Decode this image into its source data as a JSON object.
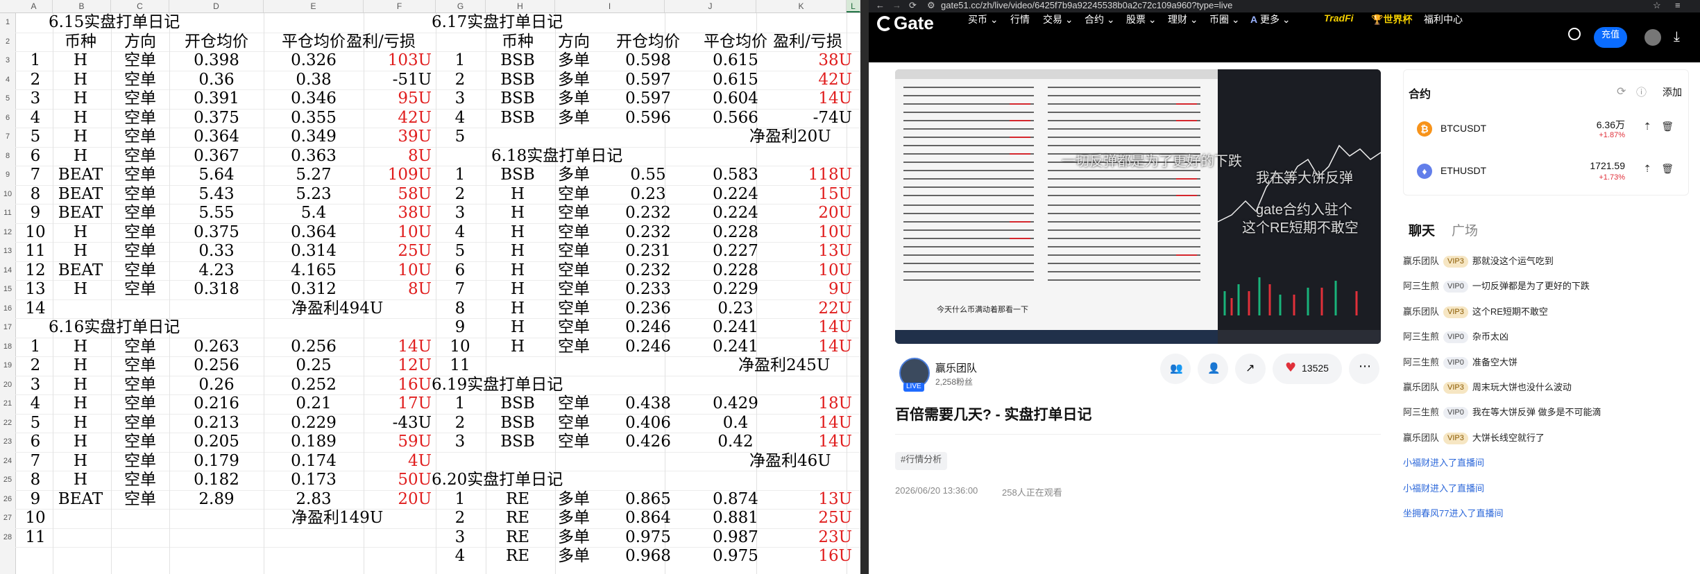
{
  "spreadsheet": {
    "columns": [
      "A",
      "B",
      "C",
      "D",
      "E",
      "F",
      "G",
      "H",
      "I",
      "J",
      "K",
      "L"
    ],
    "rows": [
      "1",
      "2",
      "3",
      "4",
      "5",
      "6",
      "7",
      "8",
      "9",
      "10",
      "11",
      "12",
      "13",
      "14",
      "15",
      "16",
      "17",
      "18",
      "19",
      "20",
      "21",
      "22",
      "23",
      "24",
      "25",
      "26",
      "27",
      "28"
    ],
    "left_block": {
      "d615": {
        "title": "6.15实盘打单日记",
        "headers": [
          "币种",
          "方向",
          "开仓均价",
          "平仓均价",
          "盈利/亏损"
        ],
        "rows": [
          [
            "1",
            "H",
            "空单",
            "0.398",
            "0.326",
            "103U"
          ],
          [
            "2",
            "H",
            "空单",
            "0.36",
            "0.38",
            "-51U"
          ],
          [
            "3",
            "H",
            "空单",
            "0.391",
            "0.346",
            "95U"
          ],
          [
            "4",
            "H",
            "空单",
            "0.375",
            "0.355",
            "42U"
          ],
          [
            "5",
            "H",
            "空单",
            "0.364",
            "0.349",
            "39U"
          ],
          [
            "6",
            "H",
            "空单",
            "0.367",
            "0.363",
            "8U"
          ],
          [
            "7",
            "BEAT",
            "空单",
            "5.64",
            "5.27",
            "109U"
          ],
          [
            "8",
            "BEAT",
            "空单",
            "5.43",
            "5.23",
            "58U"
          ],
          [
            "9",
            "BEAT",
            "空单",
            "5.55",
            "5.4",
            "38U"
          ],
          [
            "10",
            "H",
            "空单",
            "0.375",
            "0.364",
            "10U"
          ],
          [
            "11",
            "H",
            "空单",
            "0.33",
            "0.314",
            "25U"
          ],
          [
            "12",
            "BEAT",
            "空单",
            "4.23",
            "4.165",
            "10U"
          ],
          [
            "13",
            "H",
            "空单",
            "0.318",
            "0.312",
            "8U"
          ]
        ],
        "tail_num": "14",
        "total": "净盈利494U"
      },
      "d616": {
        "title": "6.16实盘打单日记",
        "rows": [
          [
            "1",
            "H",
            "空单",
            "0.263",
            "0.256",
            "14U"
          ],
          [
            "2",
            "H",
            "空单",
            "0.256",
            "0.25",
            "12U"
          ],
          [
            "3",
            "H",
            "空单",
            "0.26",
            "0.252",
            "16U"
          ],
          [
            "4",
            "H",
            "空单",
            "0.216",
            "0.21",
            "17U"
          ],
          [
            "5",
            "H",
            "空单",
            "0.213",
            "0.229",
            "-43U"
          ],
          [
            "6",
            "H",
            "空单",
            "0.205",
            "0.189",
            "59U"
          ],
          [
            "7",
            "H",
            "空单",
            "0.179",
            "0.174",
            "4U"
          ],
          [
            "8",
            "H",
            "空单",
            "0.182",
            "0.173",
            "50U"
          ],
          [
            "9",
            "BEAT",
            "空单",
            "2.89",
            "2.83",
            "20U"
          ]
        ],
        "n10": "10",
        "n11": "11",
        "total": "净盈利149U"
      }
    },
    "right_block": {
      "d617": {
        "title": "6.17实盘打单日记",
        "headers": [
          "币种",
          "方向",
          "开仓均价",
          "平仓均价",
          "盈利/亏损"
        ],
        "rows": [
          [
            "1",
            "BSB",
            "多单",
            "0.598",
            "0.615",
            "38U"
          ],
          [
            "2",
            "BSB",
            "多单",
            "0.597",
            "0.615",
            "42U"
          ],
          [
            "3",
            "BSB",
            "多单",
            "0.597",
            "0.604",
            "14U"
          ],
          [
            "4",
            "BSB",
            "多单",
            "0.596",
            "0.566",
            "-74U"
          ]
        ],
        "n5": "5",
        "total": "净盈利20U"
      },
      "d618": {
        "title": "6.18实盘打单日记",
        "rows": [
          [
            "1",
            "BSB",
            "多单",
            "0.55",
            "0.583",
            "118U"
          ],
          [
            "2",
            "H",
            "空单",
            "0.23",
            "0.224",
            "15U"
          ],
          [
            "3",
            "H",
            "空单",
            "0.232",
            "0.224",
            "20U"
          ],
          [
            "4",
            "H",
            "空单",
            "0.232",
            "0.228",
            "10U"
          ],
          [
            "5",
            "H",
            "空单",
            "0.231",
            "0.227",
            "13U"
          ],
          [
            "6",
            "H",
            "空单",
            "0.232",
            "0.228",
            "10U"
          ],
          [
            "7",
            "H",
            "空单",
            "0.233",
            "0.229",
            "9U"
          ],
          [
            "8",
            "H",
            "空单",
            "0.236",
            "0.23",
            "22U"
          ],
          [
            "9",
            "H",
            "空单",
            "0.246",
            "0.241",
            "14U"
          ],
          [
            "10",
            "H",
            "空单",
            "0.246",
            "0.241",
            "14U"
          ]
        ],
        "n11": "11",
        "total": "净盈利245U"
      },
      "d619": {
        "title": "6.19实盘打单日记",
        "rows": [
          [
            "1",
            "BSB",
            "空单",
            "0.438",
            "0.429",
            "18U"
          ],
          [
            "2",
            "BSB",
            "空单",
            "0.406",
            "0.4",
            "14U"
          ],
          [
            "3",
            "BSB",
            "空单",
            "0.426",
            "0.42",
            "14U"
          ]
        ],
        "total": "净盈利46U"
      },
      "d620": {
        "title": "6.20实盘打单日记",
        "rows": [
          [
            "1",
            "RE",
            "多单",
            "0.865",
            "0.874",
            "13U"
          ],
          [
            "2",
            "RE",
            "多单",
            "0.864",
            "0.881",
            "25U"
          ],
          [
            "3",
            "RE",
            "多单",
            "0.975",
            "0.987",
            "23U"
          ],
          [
            "4",
            "RE",
            "多单",
            "0.968",
            "0.975",
            "16U"
          ]
        ]
      }
    }
  },
  "browser": {
    "url": "gate51.cc/zh/live/video/6425f7b9a92245538b0a2c72c109a960?type=live",
    "nav": {
      "logo": "Gate",
      "items": [
        "买币",
        "行情",
        "交易",
        "合约",
        "股票",
        "理财",
        "币圈",
        "更多"
      ],
      "tradfi": "TradFi",
      "worldcup": "世界杯",
      "welfare": "福利中心",
      "deposit": "充值"
    },
    "video": {
      "overlay_line1": "一切反弹都是为了更好的下跌",
      "overlay_line2": "我在等大饼反弹",
      "overlay_line3": "gate合约入驻个",
      "overlay_line4": "这个RE短期不敢空",
      "caption": "今天什么币满动着那看一下"
    },
    "streamer": {
      "name": "赢乐团队",
      "fans": "2,258粉丝",
      "live": "LIVE",
      "likes": "13525"
    },
    "title": "百倍需要几天? - 实盘打单日记",
    "tag": "#行情分析",
    "time": "2026/06/20 13:36:00",
    "viewers": "258人正在观看",
    "side": {
      "contracts_title": "合约",
      "add_label": "添加",
      "coins": [
        {
          "name": "BTCUSDT",
          "price": "6.36万",
          "change": "+1.87%",
          "icon": "bitcoin-icon",
          "color": "#f7931a"
        },
        {
          "name": "ETHUSDT",
          "price": "1721.59",
          "change": "+1.73%",
          "icon": "ethereum-icon",
          "color": "#627eea"
        }
      ],
      "tabs": [
        "聊天",
        "广场"
      ],
      "chat": [
        {
          "user": "赢乐团队",
          "vip": "VIP3",
          "msg": "那就没这个运气吃到"
        },
        {
          "user": "阿三生煎",
          "vip": "VIP0",
          "msg": "一切反弹都是为了更好的下跌"
        },
        {
          "user": "赢乐团队",
          "vip": "VIP3",
          "msg": "这个RE短期不敢空"
        },
        {
          "user": "阿三生煎",
          "vip": "VIP0",
          "msg": "杂币太凶"
        },
        {
          "user": "阿三生煎",
          "vip": "VIP0",
          "msg": "准备空大饼"
        },
        {
          "user": "赢乐团队",
          "vip": "VIP3",
          "msg": "周末玩大饼也没什么波动"
        },
        {
          "user": "阿三生煎",
          "vip": "VIP0",
          "msg": "我在等大饼反弹 做多是不可能滴"
        },
        {
          "user": "赢乐团队",
          "vip": "VIP3",
          "msg": "大饼长线空就行了"
        }
      ],
      "joins": [
        "小福财进入了直播间",
        "小福财进入了直播间",
        "坐拥春风77进入了直播间"
      ]
    },
    "colors": {
      "accent": "#0a6cff",
      "up": "#e0303a",
      "nav_bg": "#000000",
      "link": "#2a66d9"
    }
  }
}
